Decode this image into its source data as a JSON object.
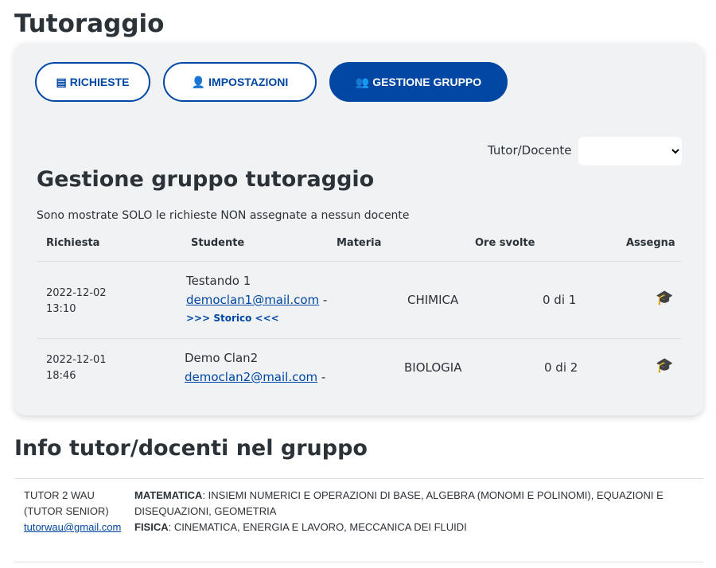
{
  "title": "Tutoraggio",
  "tabs": [
    {
      "label": "RICHIESTE",
      "icon": "file-icon"
    },
    {
      "label": "IMPOSTAZIONI",
      "icon": "user-gear-icon"
    },
    {
      "label": "GESTIONE GRUPPO",
      "icon": "users-gear-icon"
    }
  ],
  "filter": {
    "label": "Tutor/Docente",
    "value": ""
  },
  "section_title": "Gestione gruppo tutoraggio",
  "note": "Sono mostrate SOLO le richieste NON assegnate a nessun docente",
  "columns": [
    "Richiesta",
    "Studente",
    "Materia",
    "Ore svolte",
    "Assegna"
  ],
  "rows": [
    {
      "date": "2022-12-02",
      "time": "13:10",
      "name": "Testando 1",
      "email": "democlan1@mail.com",
      "sep": "-",
      "history": ">>> Storico <<<",
      "subject": "CHIMICA",
      "hours": "0 di 1"
    },
    {
      "date": "2022-12-01",
      "time": "18:46",
      "name": "Demo Clan2",
      "email": "democlan2@mail.com",
      "sep": "-",
      "subject": "BIOLOGIA",
      "hours": "0 di 2"
    }
  ],
  "info_title": "Info tutor/docenti nel gruppo",
  "tutor": {
    "name": "TUTOR 2 WAU",
    "role": "(TUTOR SENIOR)",
    "email": "tutorwau@gmail.com",
    "subjects": [
      {
        "name": "MATEMATICA",
        "topics": ": INSIEMI NUMERICI E OPERAZIONI DI BASE, ALGEBRA (MONOMI E POLINOMI), EQUAZIONI E DISEQUAZIONI, GEOMETRIA"
      },
      {
        "name": "FISICA",
        "topics": ": CINEMATICA, ENERGIA E LAVORO, MECCANICA DEI FLUIDI"
      }
    ]
  },
  "colors": {
    "primary": "#0047a3"
  }
}
